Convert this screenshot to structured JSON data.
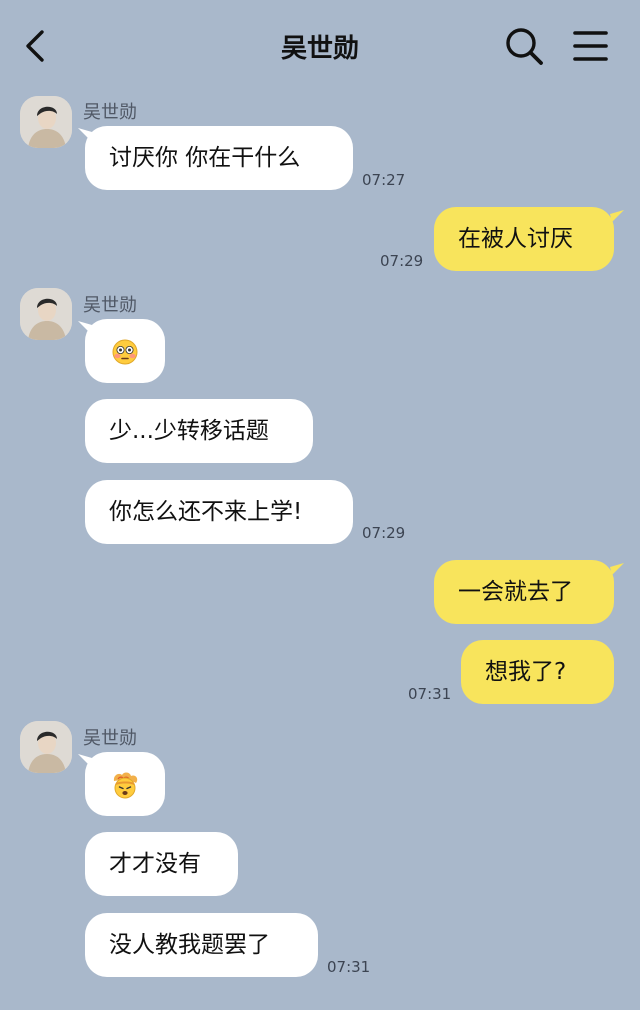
{
  "header": {
    "title": "吴世勋"
  },
  "contact": {
    "name": "吴世勋"
  },
  "messages": [
    {
      "side": "in",
      "text": "讨厌你 你在干什么",
      "time": "07:27"
    },
    {
      "side": "out",
      "text": "在被人讨厌",
      "time": "07:29"
    },
    {
      "side": "in",
      "emoji": "flushed-face"
    },
    {
      "side": "in",
      "text": "少...少转移话题"
    },
    {
      "side": "in",
      "text": "你怎么还不来上学!",
      "time": "07:29"
    },
    {
      "side": "out",
      "text": "一会就去了"
    },
    {
      "side": "out",
      "text": "想我了?",
      "time": "07:31"
    },
    {
      "side": "in",
      "emoji": "exploding-head"
    },
    {
      "side": "in",
      "text": "才才没有"
    },
    {
      "side": "in",
      "text": "没人教我题罢了",
      "time": "07:31"
    }
  ],
  "colors": {
    "background": "#a9b8cb",
    "incoming_bubble": "#ffffff",
    "outgoing_bubble": "#f8e45c"
  },
  "icons": [
    "back-arrow-icon",
    "search-icon",
    "menu-icon",
    "flushed-face-emoji",
    "exploding-head-emoji"
  ]
}
